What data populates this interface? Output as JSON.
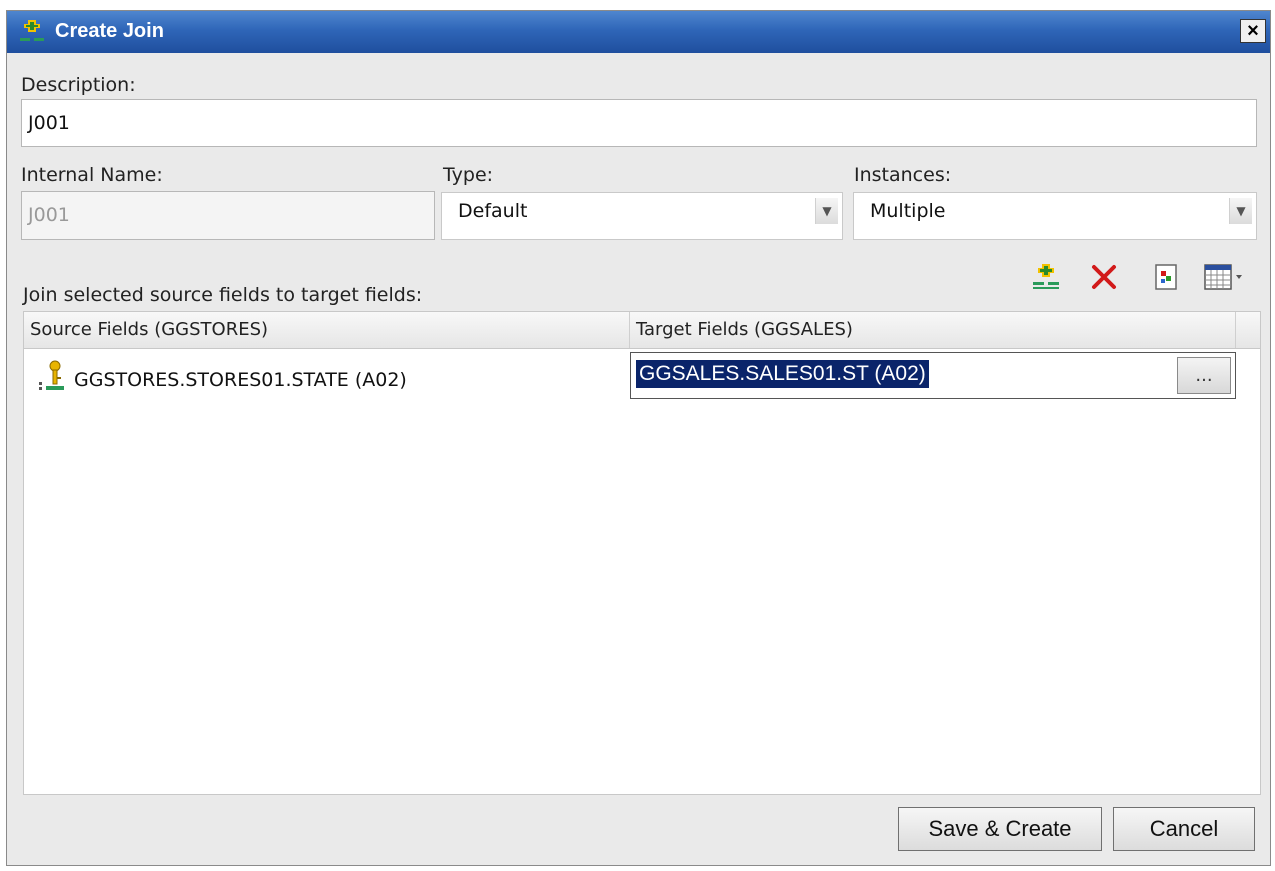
{
  "dialog": {
    "title": "Create Join",
    "close_label": "×"
  },
  "form": {
    "description_label": "Description:",
    "description_value": "J001",
    "internal_name_label": "Internal Name:",
    "internal_name_value": "J001",
    "type_label": "Type:",
    "type_value": "Default",
    "instances_label": "Instances:",
    "instances_value": "Multiple"
  },
  "join": {
    "instruction": "Join selected source fields to target fields:",
    "toolbar_icons": [
      "add-join-icon",
      "delete-icon",
      "properties-icon",
      "columns-menu-icon"
    ],
    "columns": [
      "Source Fields (GGSTORES)",
      "Target Fields (GGSALES)"
    ],
    "rows": [
      {
        "source": "GGSTORES.STORES01.STATE (A02)",
        "target": "GGSALES.SALES01.ST (A02)"
      }
    ],
    "ellipsis_label": "..."
  },
  "buttons": {
    "save_create": "Save & Create",
    "cancel": "Cancel"
  },
  "colors": {
    "titlebar": "#2f66b8",
    "selection": "#0a246a",
    "delete": "#d21a1a"
  }
}
